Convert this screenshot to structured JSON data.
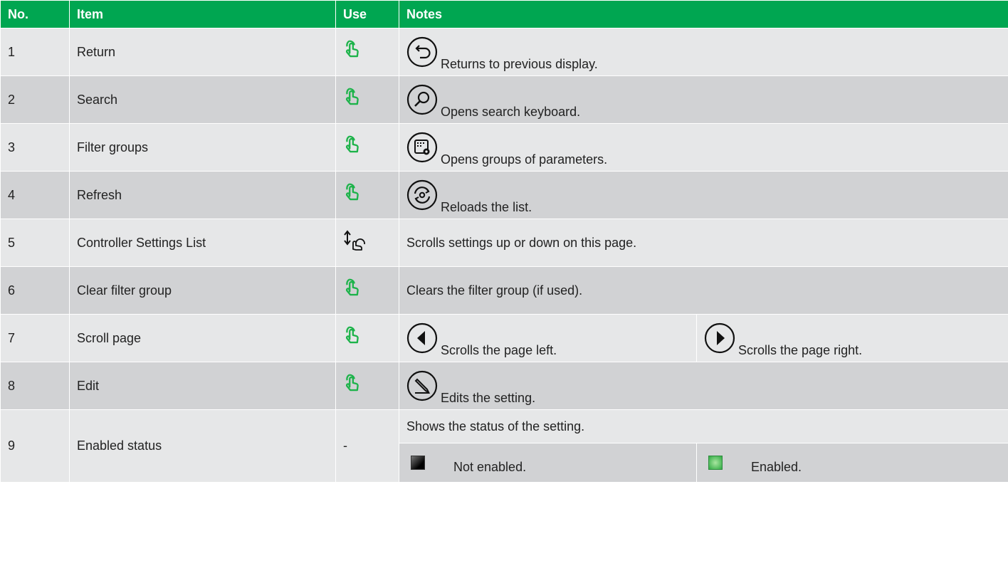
{
  "header": {
    "no": "No.",
    "item": "Item",
    "use": "Use",
    "notes": "Notes"
  },
  "rows": [
    {
      "no": "1",
      "item": "Return",
      "use_icon": "touch-icon",
      "note_icon": "return-icon",
      "note": "Returns to previous display."
    },
    {
      "no": "2",
      "item": "Search",
      "use_icon": "touch-icon",
      "note_icon": "search-icon",
      "note": "Opens search keyboard."
    },
    {
      "no": "3",
      "item": "Filter groups",
      "use_icon": "touch-icon",
      "note_icon": "filter-groups-icon",
      "note": "Opens groups of parameters."
    },
    {
      "no": "4",
      "item": "Refresh",
      "use_icon": "touch-icon",
      "note_icon": "refresh-icon",
      "note": "Reloads the list."
    },
    {
      "no": "5",
      "item": "Controller Settings List",
      "use_icon": "scroll-touch-icon",
      "note": "Scrolls settings up or down on this page."
    },
    {
      "no": "6",
      "item": "Clear filter group",
      "use_icon": "touch-icon",
      "note": "Clears the filter group (if used)."
    },
    {
      "no": "7",
      "item": "Scroll page",
      "use_icon": "touch-icon",
      "note_left": "Scrolls the page left.",
      "note_right": "Scrolls the page right."
    },
    {
      "no": "8",
      "item": "Edit",
      "use_icon": "touch-icon",
      "note_icon": "edit-icon",
      "note": "Edits the setting."
    },
    {
      "no": "9",
      "item": "Enabled status",
      "use": "-",
      "note": "Shows the status of the setting.",
      "status_off": "Not enabled.",
      "status_on": "Enabled."
    }
  ],
  "colors": {
    "header_bg": "#00a651",
    "row_light": "#e6e7e8",
    "row_dark": "#d1d2d4",
    "icon_green": "#1db34a"
  }
}
